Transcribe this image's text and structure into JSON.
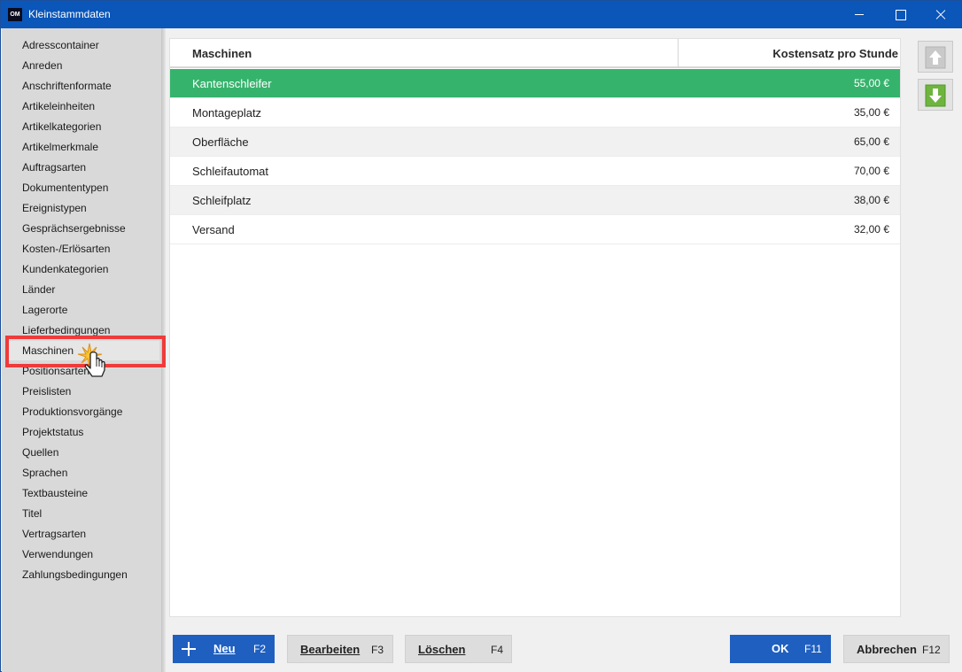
{
  "window": {
    "title": "Kleinstammdaten",
    "app_icon_text": "OM",
    "controls": [
      "minimize-icon",
      "maximize-icon",
      "close-icon"
    ]
  },
  "sidebar": {
    "items": [
      {
        "label": "Adresscontainer"
      },
      {
        "label": "Anreden"
      },
      {
        "label": "Anschriftenformate"
      },
      {
        "label": "Artikeleinheiten"
      },
      {
        "label": "Artikelkategorien"
      },
      {
        "label": "Artikelmerkmale"
      },
      {
        "label": "Auftragsarten"
      },
      {
        "label": "Dokumententypen"
      },
      {
        "label": "Ereignistypen"
      },
      {
        "label": "Gesprächsergebnisse"
      },
      {
        "label": "Kosten-/Erlösarten"
      },
      {
        "label": "Kundenkategorien"
      },
      {
        "label": "Länder"
      },
      {
        "label": "Lagerorte"
      },
      {
        "label": "Lieferbedingungen"
      },
      {
        "label": "Maschinen"
      },
      {
        "label": "Positionsarten"
      },
      {
        "label": "Preislisten"
      },
      {
        "label": "Produktionsvorgänge"
      },
      {
        "label": "Projektstatus"
      },
      {
        "label": "Quellen"
      },
      {
        "label": "Sprachen"
      },
      {
        "label": "Textbausteine"
      },
      {
        "label": "Titel"
      },
      {
        "label": "Vertragsarten"
      },
      {
        "label": "Verwendungen"
      },
      {
        "label": "Zahlungsbedingungen"
      }
    ],
    "selected": "Maschinen"
  },
  "grid": {
    "columns": [
      "Maschinen",
      "Kostensatz pro Stunde"
    ],
    "rows": [
      {
        "name": "Kantenschleifer",
        "rate": "55,00 €"
      },
      {
        "name": "Montageplatz",
        "rate": "35,00 €"
      },
      {
        "name": "Oberfläche",
        "rate": "65,00 €"
      },
      {
        "name": "Schleifautomat",
        "rate": "70,00 €"
      },
      {
        "name": "Schleifplatz",
        "rate": "38,00 €"
      },
      {
        "name": "Versand",
        "rate": "32,00 €"
      }
    ],
    "selected_row": "Kantenschleifer"
  },
  "side_buttons": {
    "up_icon": "arrow-up-icon",
    "down_icon": "arrow-down-icon"
  },
  "footer": {
    "new": {
      "label": "Neu",
      "key": "F2"
    },
    "edit": {
      "label": "Bearbeiten",
      "key": "F3"
    },
    "delete": {
      "label": "Löschen",
      "key": "F4"
    },
    "ok": {
      "label": "OK",
      "key": "F11"
    },
    "cancel": {
      "label": "Abbrechen",
      "key": "F12"
    }
  },
  "colors": {
    "titlebar": "#0a56b9",
    "selected_row": "#35b36c",
    "primary_button": "#1f5fc0",
    "highlight_box": "#ef3b3b",
    "arrow_down": "#6fb43f"
  }
}
